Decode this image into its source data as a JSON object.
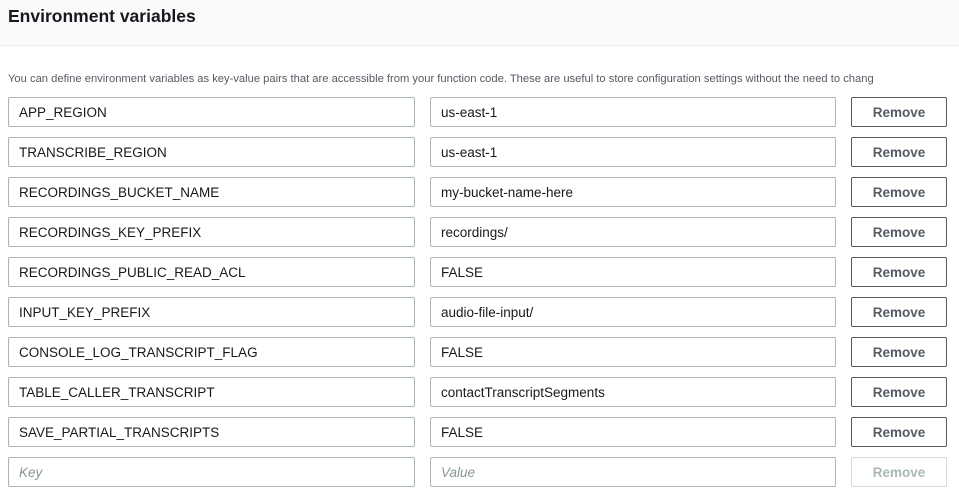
{
  "section": {
    "title": "Environment variables",
    "description": "You can define environment variables as key-value pairs that are accessible from your function code. These are useful to store configuration settings without the need to chang"
  },
  "variables": [
    {
      "key": "APP_REGION",
      "value": "us-east-1"
    },
    {
      "key": "TRANSCRIBE_REGION",
      "value": "us-east-1"
    },
    {
      "key": "RECORDINGS_BUCKET_NAME",
      "value": "my-bucket-name-here"
    },
    {
      "key": "RECORDINGS_KEY_PREFIX",
      "value": "recordings/"
    },
    {
      "key": "RECORDINGS_PUBLIC_READ_ACL",
      "value": "FALSE"
    },
    {
      "key": "INPUT_KEY_PREFIX",
      "value": "audio-file-input/"
    },
    {
      "key": "CONSOLE_LOG_TRANSCRIPT_FLAG",
      "value": "FALSE"
    },
    {
      "key": "TABLE_CALLER_TRANSCRIPT",
      "value": "contactTranscriptSegments"
    },
    {
      "key": "SAVE_PARTIAL_TRANSCRIPTS",
      "value": "FALSE"
    }
  ],
  "new_row": {
    "key_placeholder": "Key",
    "value_placeholder": "Value"
  },
  "remove_label": "Remove"
}
